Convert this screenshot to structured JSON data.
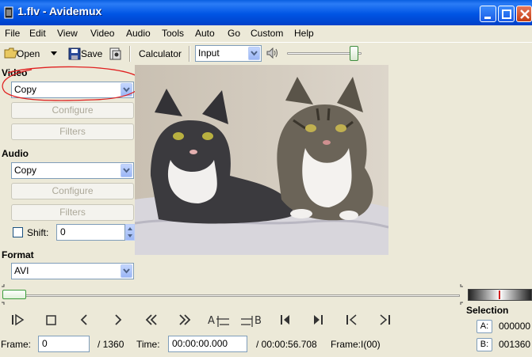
{
  "window": {
    "title": "1.flv - Avidemux"
  },
  "menu": [
    "File",
    "Edit",
    "View",
    "Video",
    "Audio",
    "Tools",
    "Auto",
    "Go",
    "Custom",
    "Help"
  ],
  "toolbar": {
    "open_label": "Open",
    "save_label": "Save",
    "calculator_label": "Calculator",
    "input_value": "Input",
    "volume_level": 0.95
  },
  "video_section": {
    "label": "Video",
    "codec_value": "Copy",
    "configure_label": "Configure",
    "filters_label": "Filters"
  },
  "audio_section": {
    "label": "Audio",
    "codec_value": "Copy",
    "configure_label": "Configure",
    "filters_label": "Filters",
    "shift_label": "Shift:",
    "shift_value": "0"
  },
  "format_section": {
    "label": "Format",
    "value": "AVI"
  },
  "timeline": {
    "position_fraction": 0.0
  },
  "selection": {
    "label": "Selection",
    "a_label": "A:",
    "a_value": "000000",
    "b_label": "B:",
    "b_value": "001360"
  },
  "status_bar": {
    "frame_label": "Frame:",
    "frame_value": "0",
    "total_frames": "/ 1360",
    "time_label": "Time:",
    "time_value": "00:00:00.000",
    "total_time": "/ 00:00:56.708",
    "frame_type": "Frame:I(00)"
  },
  "colors": {
    "titlebar": "#0055e5",
    "annotation": "#e02020",
    "window_bg": "#ece9d8"
  }
}
